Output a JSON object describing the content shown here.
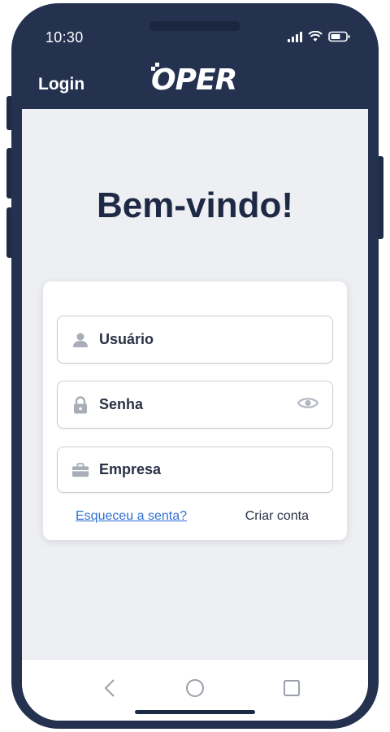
{
  "status_bar": {
    "time": "10:30"
  },
  "app_bar": {
    "title": "Login",
    "logo_text": "OPER"
  },
  "main": {
    "welcome": "Bem-vindo!"
  },
  "form": {
    "username": {
      "placeholder": "Usuário",
      "icon": "user-icon"
    },
    "password": {
      "placeholder": "Senha",
      "icon": "lock-icon",
      "toggle_icon": "eye-icon"
    },
    "company": {
      "placeholder": "Empresa",
      "icon": "briefcase-icon"
    },
    "forgot_link": "Esqueceu a senta?",
    "create_account": "Criar conta"
  },
  "nav": {
    "back": "back-icon",
    "home": "home-icon",
    "recent": "recent-apps-icon"
  },
  "colors": {
    "header": "#243250",
    "background": "#eeeff2",
    "link": "#2f6fd6",
    "text": "#1e2a45"
  }
}
